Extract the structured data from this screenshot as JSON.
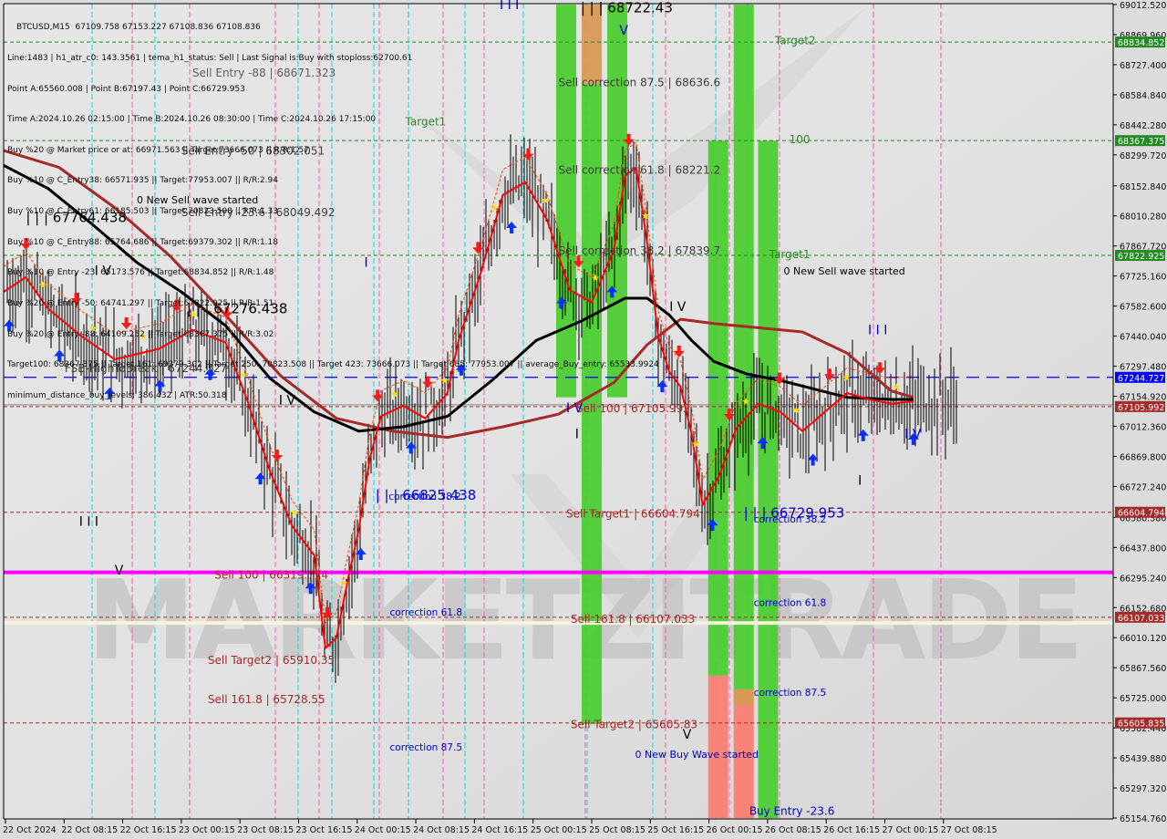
{
  "header": {
    "symbol": "BTCUSD,M15",
    "ohlc": "67109.758 67153.227 67108.836 67108.836",
    "info_lines": [
      "Line:1483 | h1_atr_c0: 143.3561 | tema_h1_status: Sell | Last Signal is:Buy with stoploss:62700.61",
      "Point A:65560.008 | Point B:67197.43 | Point C:66729.953",
      "Time A:2024.10.26 02:15:00 | Time B:2024.10.26 08:30:00 | Time C:2024.10.26 17:15:00",
      "Buy %20 @ Market price or at: 66971.563 || Target:73666.073 || R/R:1.57",
      "Buy %10 @ C_Entry38: 66571.935 || Target:77953.007 || R/R:2.94",
      "Buy %10 @ C_Entry61: 66185.503 || Target:70823.508 || R/R:1.33",
      "Buy %10 @ C_Entry88: 65764.686 || Target:69379.302 || R/R:1.18",
      "Buy %10 @ Entry -23: 65173.576 || Target:68834.852 || R/R:1.48",
      "Buy %20 @ Entry -50: 64741.297 || Target:67822.925 || R/R:1.51",
      "Buy %20 @ Entry -88: 64109.252 || Target:68367.375 || R/R:3.02",
      "Target100: 68367.375 || Target 161: 69379.302 || Target 250: 70823.508 || Target 423: 73666.073 || Target 685: 77953.007 || average_Buy_entry: 65533.9924",
      "minimum_distance_buy_levels: 386.432 | ATR:50.318"
    ]
  },
  "watermark": "MARKETZITRADE",
  "colors": {
    "background": "#dcdcdc",
    "candle": "#000000",
    "ma_slow": "#a52a2a",
    "ma_mid": "#000000",
    "tema": "#ff0000",
    "channel": "#ff4500",
    "target_line": "#228b22",
    "sell_line": "#a52a2a",
    "fsb_line": "#0000ff",
    "magenta_line": "#ff00ff",
    "zone_green": "#4ccc30",
    "zone_orange": "#d89a55",
    "zone_salmon": "#fa8072",
    "label_blue": "#0000cc",
    "label_green": "#2e8b2e",
    "label_darkred": "#a52a2a"
  },
  "chart_data": {
    "type": "candlestick",
    "title": "BTCUSD,M15",
    "xlabel": "",
    "ylabel": "",
    "ylim": [
      65154.76,
      69012.52
    ],
    "y_ticks": [
      "69012.520",
      "68869.960",
      "68727.400",
      "68584.840",
      "68442.280",
      "68299.720",
      "68152.840",
      "68010.280",
      "67867.720",
      "67725.160",
      "67582.600",
      "67440.040",
      "67297.480",
      "67154.920",
      "67012.360",
      "66869.800",
      "66727.240",
      "66580.380",
      "66437.800",
      "66295.240",
      "66152.680",
      "66010.120",
      "65867.560",
      "65725.000",
      "65582.440",
      "65439.880",
      "65297.320",
      "65154.760"
    ],
    "x_ticks": [
      "22 Oct 2024",
      "22 Oct 08:15",
      "22 Oct 16:15",
      "23 Oct 00:15",
      "23 Oct 08:15",
      "23 Oct 16:15",
      "24 Oct 00:15",
      "24 Oct 08:15",
      "24 Oct 16:15",
      "25 Oct 00:15",
      "25 Oct 08:15",
      "25 Oct 16:15",
      "26 Oct 00:15",
      "26 Oct 08:15",
      "26 Oct 16:15",
      "27 Oct 00:15",
      "27 Oct 08:15"
    ],
    "price_badges": [
      {
        "value": "68834.852",
        "color": "#228b22"
      },
      {
        "value": "68367.375",
        "color": "#228b22"
      },
      {
        "value": "67822.925",
        "color": "#228b22"
      },
      {
        "value": "67244.727",
        "color": "#0000ff"
      },
      {
        "value": "67105.992",
        "color": "#a52a2a"
      },
      {
        "value": "66604.794",
        "color": "#a52a2a"
      },
      {
        "value": "66107.033",
        "color": "#a52a2a"
      },
      {
        "value": "65605.835",
        "color": "#a52a2a"
      }
    ],
    "horizontal_levels": [
      {
        "name": "Target2",
        "price": 68834.852,
        "style": "green-dashed"
      },
      {
        "name": "Target100",
        "price": 68367.375,
        "style": "green-dashed"
      },
      {
        "name": "Target1",
        "price": 67822.925,
        "style": "green-dashed"
      },
      {
        "name": "FSB-HighToBreak",
        "price": 67244.727,
        "style": "blue-dashed"
      },
      {
        "name": "Sell 100",
        "price": 67105.992,
        "style": "darkred-dashed"
      },
      {
        "name": "Sell Target1",
        "price": 66604.794,
        "style": "darkred-dashed"
      },
      {
        "name": "Magenta",
        "price": 66319.774,
        "style": "magenta-solid"
      },
      {
        "name": "Sell 161.8",
        "price": 66107.033,
        "style": "darkred-dashed"
      },
      {
        "name": "Sell Target2",
        "price": 65605.835,
        "style": "darkred-dashed"
      }
    ],
    "annotations": [
      {
        "text": "Sell Entry -88 | 68671.323",
        "x": 0.17,
        "price": 68671.3,
        "color": "#606060"
      },
      {
        "text": "Sell Entry -50 | 68302.051",
        "x": 0.16,
        "price": 68302.0,
        "color": "#404040"
      },
      {
        "text": "0 New Sell wave started",
        "x": 0.12,
        "price": 68070.0,
        "color": "#000000"
      },
      {
        "text": "Sell Entry -23.6 | 68049.492",
        "x": 0.16,
        "price": 68010.0,
        "color": "#404040"
      },
      {
        "text": "| | | 67764.438",
        "x": 0.02,
        "price": 67980.0,
        "color": "#000000"
      },
      {
        "text": "| | | 67276.438",
        "x": 0.165,
        "price": 67548.0,
        "color": "#000000"
      },
      {
        "text": "FSB-HighToBreak | 67244.727",
        "x": 0.055,
        "price": 67270.0,
        "color": "#404040"
      },
      {
        "text": "Target1",
        "x": 0.362,
        "price": 68440.0,
        "color": "#2e8b2e"
      },
      {
        "text": "| | | 68722.43",
        "x": 0.52,
        "price": 68975.0,
        "color": "#000000"
      },
      {
        "text": "Sell correction 87.5 | 68636.6",
        "x": 0.5,
        "price": 68625.0,
        "color": "#404040"
      },
      {
        "text": "Sell correction 61.8 | 68221.2",
        "x": 0.5,
        "price": 68210.0,
        "color": "#404040"
      },
      {
        "text": "Sell correction 38.2 | 67839.7",
        "x": 0.5,
        "price": 67828.0,
        "color": "#404040"
      },
      {
        "text": "Target2",
        "x": 0.695,
        "price": 68825.0,
        "color": "#2e8b2e"
      },
      {
        "text": "100",
        "x": 0.708,
        "price": 68355.0,
        "color": "#2e8b2e"
      },
      {
        "text": "Target1",
        "x": 0.69,
        "price": 67810.0,
        "color": "#2e8b2e"
      },
      {
        "text": "0 New Sell wave started",
        "x": 0.703,
        "price": 67732.0,
        "color": "#000000"
      },
      {
        "text": "Sell 100 | 67105.992",
        "x": 0.516,
        "price": 67080.0,
        "color": "#a52a2a"
      },
      {
        "text": "Sell Target1 | 66604.794",
        "x": 0.507,
        "price": 66580.0,
        "color": "#a52a2a"
      },
      {
        "text": "| | | 66729.953",
        "x": 0.667,
        "price": 66580.0,
        "color": "#0000cc"
      },
      {
        "text": "correction 38.2",
        "x": 0.676,
        "price": 66555.0,
        "color": "#0000cc"
      },
      {
        "text": "| | | 66825.438",
        "x": 0.335,
        "price": 66665.0,
        "color": "#0000cc"
      },
      {
        "text": "correction 38.2",
        "x": 0.347,
        "price": 66665.0,
        "color": "#0000cc"
      },
      {
        "text": "Sell 100 | 66319.774",
        "x": 0.19,
        "price": 66290.0,
        "color": "#a52a2a"
      },
      {
        "text": "correction 61.8",
        "x": 0.348,
        "price": 66115.0,
        "color": "#0000cc"
      },
      {
        "text": "correction 61.8",
        "x": 0.676,
        "price": 66160.0,
        "color": "#0000cc"
      },
      {
        "text": "Sell 161.8 | 66107.033",
        "x": 0.511,
        "price": 66080.0,
        "color": "#a52a2a"
      },
      {
        "text": "Sell Target2 | 65910.35",
        "x": 0.184,
        "price": 65885.0,
        "color": "#a52a2a"
      },
      {
        "text": "Sell 161.8 | 65728.55",
        "x": 0.184,
        "price": 65700.0,
        "color": "#a52a2a"
      },
      {
        "text": "correction 87.5",
        "x": 0.676,
        "price": 65735.0,
        "color": "#0000cc"
      },
      {
        "text": "Sell Target2 | 65605.83",
        "x": 0.511,
        "price": 65580.0,
        "color": "#a52a2a"
      },
      {
        "text": "correction 87.5",
        "x": 0.348,
        "price": 65475.0,
        "color": "#0000cc"
      },
      {
        "text": "0 New Buy Wave started",
        "x": 0.569,
        "price": 65440.0,
        "color": "#0000cc"
      },
      {
        "text": "Buy Entry -23.6",
        "x": 0.672,
        "price": 65170.0,
        "color": "#0000cc"
      }
    ],
    "wave_labels": [
      {
        "text": "I I I",
        "x": 0.447,
        "price": 68990.0,
        "color": "#0000cc"
      },
      {
        "text": "V",
        "x": 0.555,
        "price": 68870.0,
        "color": "#0000cc"
      },
      {
        "text": "I V",
        "x": 0.082,
        "price": 67730.0,
        "color": "#000000"
      },
      {
        "text": "I",
        "x": 0.325,
        "price": 67770.0,
        "color": "#0000cc"
      },
      {
        "text": "I V",
        "x": 0.6,
        "price": 67560.0,
        "color": "#000000"
      },
      {
        "text": "I V",
        "x": 0.248,
        "price": 67115.0,
        "color": "#000000"
      },
      {
        "text": "I V",
        "x": 0.507,
        "price": 67080.0,
        "color": "#0000cc"
      },
      {
        "text": "I",
        "x": 0.515,
        "price": 66955.0,
        "color": "#000000"
      },
      {
        "text": "I I I",
        "x": 0.779,
        "price": 67450.0,
        "color": "#0000cc"
      },
      {
        "text": "I V",
        "x": 0.812,
        "price": 66955.0,
        "color": "#0000cc"
      },
      {
        "text": "I",
        "x": 0.77,
        "price": 66735.0,
        "color": "#000000"
      },
      {
        "text": "I I I",
        "x": 0.068,
        "price": 66540.0,
        "color": "#000000"
      },
      {
        "text": "V",
        "x": 0.1,
        "price": 66310.0,
        "color": "#000000"
      },
      {
        "text": "V",
        "x": 0.612,
        "price": 65530.0,
        "color": "#000000"
      }
    ],
    "zones": [
      {
        "x": 0.507,
        "top": 69012.0,
        "bottom": 67150.0,
        "color": "#4ccc30"
      },
      {
        "x": 0.53,
        "top": 69012.0,
        "bottom": 68635.0,
        "color": "#d89a55"
      },
      {
        "x": 0.53,
        "top": 68635.0,
        "bottom": 65600.0,
        "color": "#4ccc30"
      },
      {
        "x": 0.553,
        "top": 69012.0,
        "bottom": 67150.0,
        "color": "#4ccc30"
      },
      {
        "x": 0.644,
        "top": 68367.0,
        "bottom": 65830.0,
        "color": "#4ccc30"
      },
      {
        "x": 0.644,
        "top": 65830.0,
        "bottom": 65154.0,
        "color": "#fa8072"
      },
      {
        "x": 0.667,
        "top": 69012.0,
        "bottom": 65765.0,
        "color": "#4ccc30"
      },
      {
        "x": 0.667,
        "top": 65765.0,
        "bottom": 65154.0,
        "color": "#fa8072"
      },
      {
        "x": 0.667,
        "top": 65765.0,
        "bottom": 65690.0,
        "color": "#d89a55"
      },
      {
        "x": 0.689,
        "top": 68367.0,
        "bottom": 65154.0,
        "color": "#4ccc30"
      }
    ],
    "series": [
      {
        "name": "MA slow",
        "color": "#a52a2a",
        "points": [
          [
            0.0,
            68320
          ],
          [
            0.05,
            68240
          ],
          [
            0.1,
            68050
          ],
          [
            0.15,
            67820
          ],
          [
            0.2,
            67540
          ],
          [
            0.25,
            67250
          ],
          [
            0.3,
            67050
          ],
          [
            0.35,
            66990
          ],
          [
            0.4,
            66960
          ],
          [
            0.45,
            67010
          ],
          [
            0.5,
            67070
          ],
          [
            0.55,
            67220
          ],
          [
            0.58,
            67400
          ],
          [
            0.61,
            67520
          ],
          [
            0.64,
            67500
          ],
          [
            0.68,
            67480
          ],
          [
            0.72,
            67460
          ],
          [
            0.76,
            67360
          ],
          [
            0.8,
            67180
          ],
          [
            0.82,
            67150
          ]
        ]
      },
      {
        "name": "MA mid",
        "color": "#000000",
        "points": [
          [
            0.0,
            68250
          ],
          [
            0.04,
            68140
          ],
          [
            0.08,
            67970
          ],
          [
            0.12,
            67790
          ],
          [
            0.16,
            67650
          ],
          [
            0.2,
            67490
          ],
          [
            0.24,
            67240
          ],
          [
            0.28,
            67080
          ],
          [
            0.32,
            66990
          ],
          [
            0.36,
            67010
          ],
          [
            0.4,
            67060
          ],
          [
            0.44,
            67230
          ],
          [
            0.48,
            67420
          ],
          [
            0.52,
            67510
          ],
          [
            0.56,
            67620
          ],
          [
            0.58,
            67620
          ],
          [
            0.6,
            67540
          ],
          [
            0.62,
            67420
          ],
          [
            0.64,
            67320
          ],
          [
            0.67,
            67260
          ],
          [
            0.7,
            67230
          ],
          [
            0.73,
            67190
          ],
          [
            0.76,
            67150
          ],
          [
            0.8,
            67140
          ],
          [
            0.82,
            67140
          ]
        ]
      },
      {
        "name": "TEMA",
        "color": "#ff0000",
        "points": [
          [
            0.0,
            67650
          ],
          [
            0.02,
            67720
          ],
          [
            0.04,
            67570
          ],
          [
            0.07,
            67440
          ],
          [
            0.1,
            67330
          ],
          [
            0.14,
            67380
          ],
          [
            0.17,
            67470
          ],
          [
            0.2,
            67410
          ],
          [
            0.22,
            67130
          ],
          [
            0.24,
            66800
          ],
          [
            0.26,
            66540
          ],
          [
            0.28,
            66400
          ],
          [
            0.29,
            65960
          ],
          [
            0.3,
            66010
          ],
          [
            0.31,
            66280
          ],
          [
            0.32,
            66520
          ],
          [
            0.33,
            66860
          ],
          [
            0.34,
            67060
          ],
          [
            0.36,
            67110
          ],
          [
            0.38,
            67050
          ],
          [
            0.4,
            67170
          ],
          [
            0.41,
            67420
          ],
          [
            0.43,
            67740
          ],
          [
            0.45,
            68110
          ],
          [
            0.47,
            68170
          ],
          [
            0.49,
            67990
          ],
          [
            0.51,
            67660
          ],
          [
            0.53,
            67600
          ],
          [
            0.55,
            67850
          ],
          [
            0.56,
            68200
          ],
          [
            0.57,
            68240
          ],
          [
            0.58,
            67880
          ],
          [
            0.59,
            67440
          ],
          [
            0.6,
            67270
          ],
          [
            0.61,
            67200
          ],
          [
            0.62,
            66980
          ],
          [
            0.63,
            66640
          ],
          [
            0.645,
            66780
          ],
          [
            0.66,
            67000
          ],
          [
            0.68,
            67120
          ],
          [
            0.7,
            67080
          ],
          [
            0.72,
            66990
          ],
          [
            0.74,
            67080
          ],
          [
            0.76,
            67170
          ],
          [
            0.78,
            67140
          ],
          [
            0.8,
            67120
          ],
          [
            0.82,
            67130
          ]
        ]
      }
    ],
    "legend": "none",
    "grid": false
  }
}
